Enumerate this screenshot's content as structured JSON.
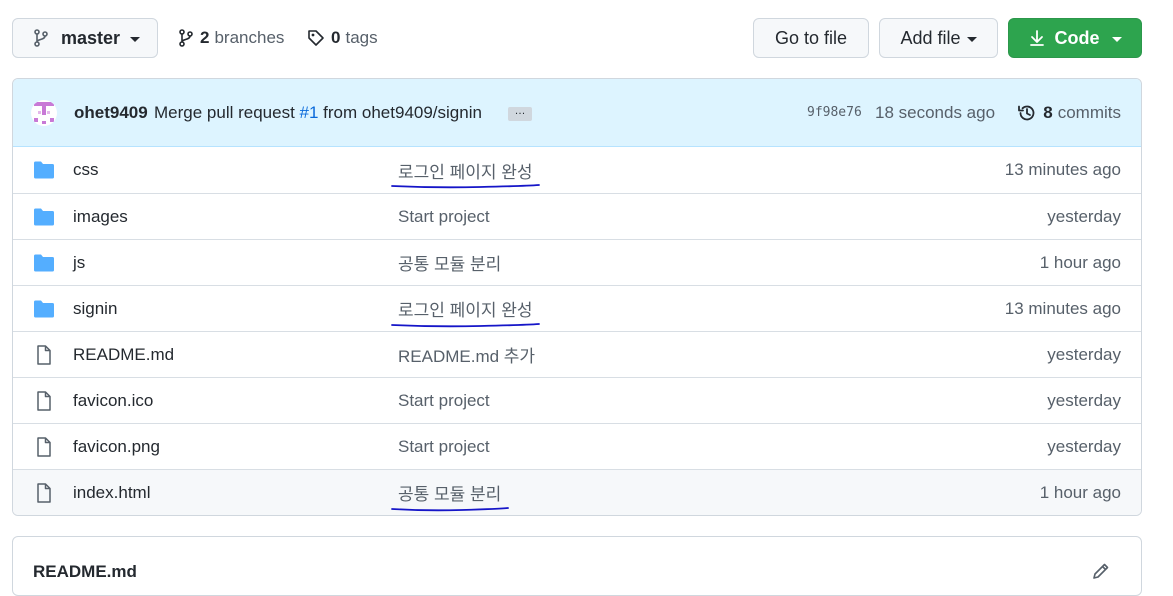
{
  "toolbar": {
    "branch_name": "master",
    "branches_count": "2",
    "branches_label": "branches",
    "tags_count": "0",
    "tags_label": "tags",
    "goto_file_label": "Go to file",
    "add_file_label": "Add file",
    "code_label": "Code"
  },
  "commit": {
    "author": "ohet9409",
    "message_prefix": "Merge pull request ",
    "pr_number": "#1",
    "message_suffix": " from ohet9409/signin",
    "ellipsis": "…",
    "sha": "9f98e76",
    "time": "18 seconds ago",
    "count": "8",
    "count_label": "commits"
  },
  "files": [
    {
      "name": "css",
      "type": "folder",
      "message": "로그인 페이지 완성",
      "time": "13 minutes ago",
      "underlined": true
    },
    {
      "name": "images",
      "type": "folder",
      "message": "Start project",
      "time": "yesterday",
      "underlined": false
    },
    {
      "name": "js",
      "type": "folder",
      "message": "공통 모듈 분리",
      "time": "1 hour ago",
      "underlined": false
    },
    {
      "name": "signin",
      "type": "folder",
      "message": "로그인 페이지 완성",
      "time": "13 minutes ago",
      "underlined": true
    },
    {
      "name": "README.md",
      "type": "file",
      "message": "README.md 추가",
      "time": "yesterday",
      "underlined": false
    },
    {
      "name": "favicon.ico",
      "type": "file",
      "message": "Start project",
      "time": "yesterday",
      "underlined": false
    },
    {
      "name": "favicon.png",
      "type": "file",
      "message": "Start project",
      "time": "yesterday",
      "underlined": false
    },
    {
      "name": "index.html",
      "type": "file",
      "message": "공통 모듈 분리",
      "time": "1 hour ago",
      "underlined": true
    }
  ],
  "readme": {
    "title": "README.md"
  },
  "colors": {
    "folder": "#54aeff",
    "file_icon": "#57606a",
    "accent_link": "#0969da",
    "code_button": "#2da44e",
    "annotation_ink": "#1515c8"
  },
  "icons": {
    "branch": "git-branch-icon",
    "tag": "tag-icon",
    "download": "download-icon",
    "history": "history-icon",
    "folder": "folder-icon",
    "file": "file-icon",
    "edit": "pencil-icon"
  }
}
